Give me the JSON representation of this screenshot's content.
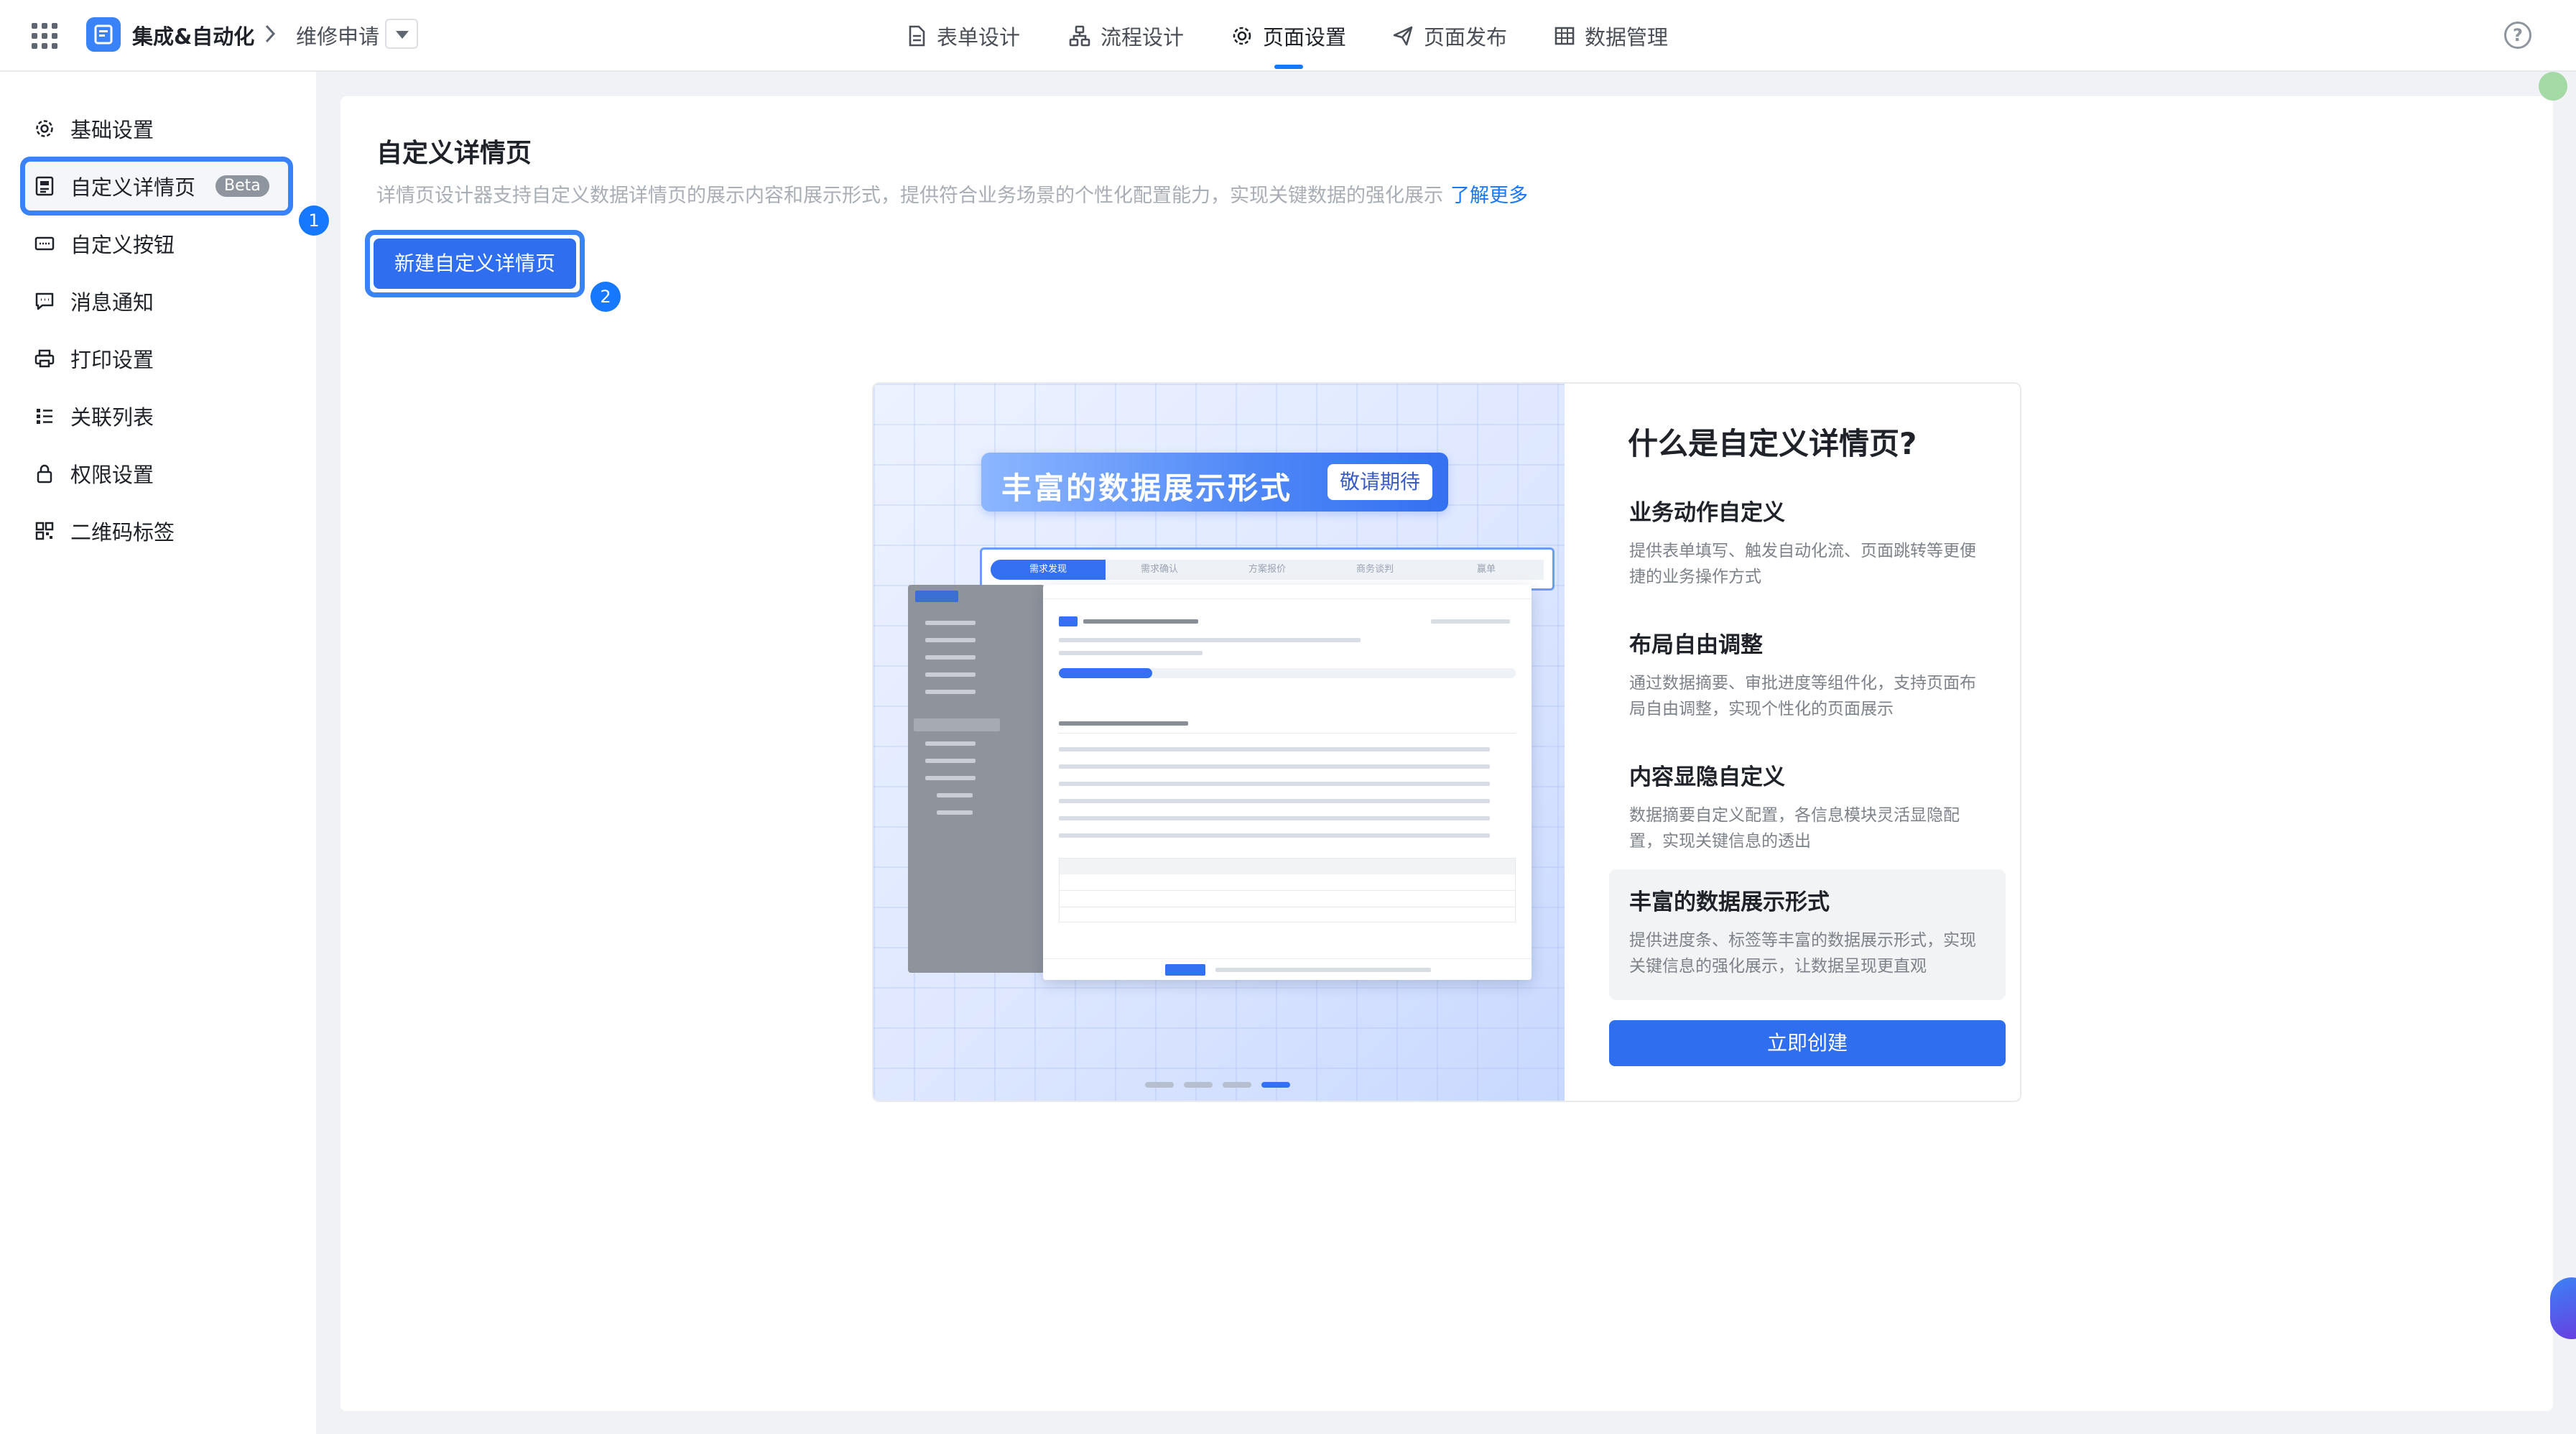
{
  "header": {
    "app_name": "集成&自动化",
    "form_name": "维修申请",
    "tabs": [
      {
        "label": "表单设计"
      },
      {
        "label": "流程设计"
      },
      {
        "label": "页面设置"
      },
      {
        "label": "页面发布"
      },
      {
        "label": "数据管理"
      }
    ],
    "active_tab": "页面设置",
    "help": "?"
  },
  "sidebar": {
    "items": [
      {
        "label": "基础设置"
      },
      {
        "label": "自定义详情页",
        "badge": "Beta"
      },
      {
        "label": "自定义按钮"
      },
      {
        "label": "消息通知"
      },
      {
        "label": "打印设置"
      },
      {
        "label": "关联列表"
      },
      {
        "label": "权限设置"
      },
      {
        "label": "二维码标签"
      }
    ],
    "active_item": "自定义详情页"
  },
  "steps": {
    "one": "1",
    "two": "2"
  },
  "main": {
    "title": "自定义详情页",
    "description": "详情页设计器支持自定义数据详情页的展示内容和展示形式，提供符合业务场景的个性化配置能力，实现关键数据的强化展示",
    "learn_more": "了解更多",
    "new_button": "新建自定义详情页"
  },
  "intro": {
    "banner_text": "丰富的数据展示形式",
    "banner_pill": "敬请期待",
    "progress_steps": [
      "需求发现",
      "需求确认",
      "方案报价",
      "商务谈判",
      "赢单"
    ],
    "carousel": {
      "count": 4,
      "active_index": 3
    },
    "title": "什么是自定义详情页?",
    "features": [
      {
        "title": "业务动作自定义",
        "desc": "提供表单填写、触发自动化流、页面跳转等更便捷的业务操作方式"
      },
      {
        "title": "布局自由调整",
        "desc": "通过数据摘要、审批进度等组件化，支持页面布局自由调整，实现个性化的页面展示"
      },
      {
        "title": "内容显隐自定义",
        "desc": "数据摘要自定义配置，各信息模块灵活显隐配置，实现关键信息的透出"
      },
      {
        "title": "丰富的数据展示形式",
        "desc": "提供进度条、标签等丰富的数据展示形式，实现关键信息的强化展示，让数据呈现更直观"
      }
    ],
    "active_feature": "丰富的数据展示形式",
    "create_button": "立即创建"
  },
  "colors": {
    "accent": "#1677ff",
    "highlight_outline": "#3a82f7",
    "button": "#2f6fef"
  }
}
